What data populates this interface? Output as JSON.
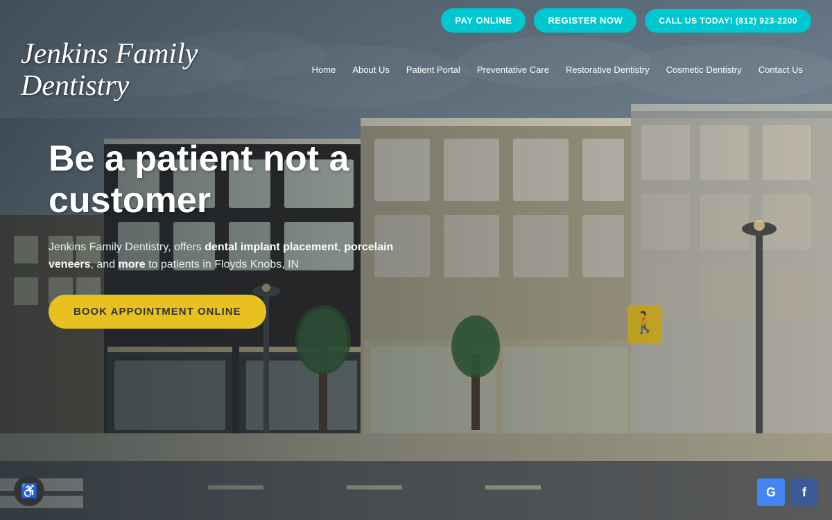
{
  "site": {
    "logo": "Jenkins Family Dentistry",
    "tagline": "Be a patient not a customer",
    "description_prefix": "Jenkins Family Dentistry, offers ",
    "description_bold1": "dental implant placement",
    "description_separator1": ", ",
    "description_bold2": "porcelain veneers",
    "description_separator2": ", and ",
    "description_bold3": "more",
    "description_suffix": " to patients in Floyds Knobs, IN"
  },
  "top_bar": {
    "pay_online": "PAY ONLINE",
    "register_now": "REGISTER NOW",
    "call_us": "CALL US TODAY! (812) 923-2200"
  },
  "nav": {
    "items": [
      {
        "id": "home",
        "label": "Home"
      },
      {
        "id": "about",
        "label": "About Us"
      },
      {
        "id": "patient-portal",
        "label": "Patient Portal"
      },
      {
        "id": "preventative-care",
        "label": "Preventative Care"
      },
      {
        "id": "restorative-dentistry",
        "label": "Restorative Dentistry"
      },
      {
        "id": "cosmetic-dentistry",
        "label": "Cosmetic Dentistry"
      },
      {
        "id": "contact-us",
        "label": "Contact Us"
      }
    ]
  },
  "hero": {
    "book_btn": "BOOK APPOINTMENT ONLINE"
  },
  "social": {
    "google_label": "G",
    "facebook_label": "f"
  },
  "accessibility": {
    "icon": "♿"
  },
  "colors": {
    "cyan": "#00c8d0",
    "yellow": "#e8c020",
    "google_blue": "#4285f4",
    "facebook_blue": "#3b5998"
  }
}
